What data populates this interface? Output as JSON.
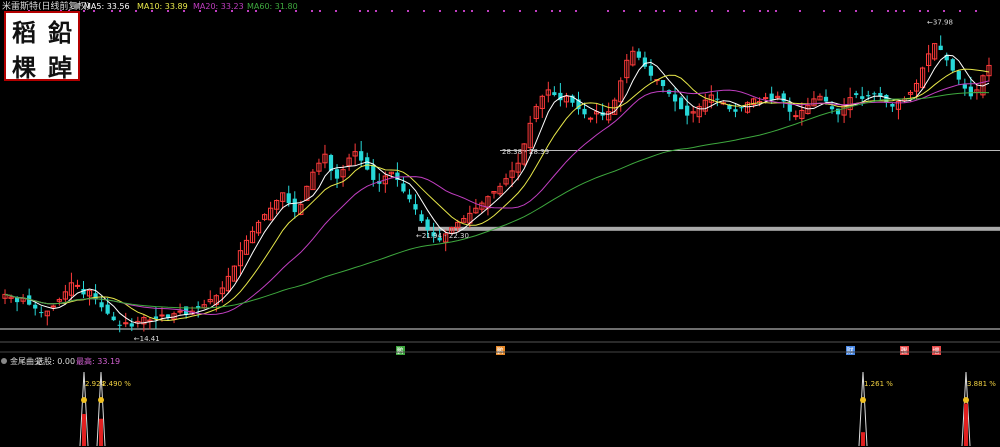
{
  "header": {
    "stock_name": "米雷斯特(日线前复权)",
    "ma5": "MA5: 33.56",
    "ma10": "MA10: 33.89",
    "ma20": "MA20: 33.23",
    "ma60": "MA60: 31.80"
  },
  "seal": {
    "chars": [
      "稻",
      "鉛",
      "棵",
      "踔"
    ]
  },
  "chart_data": [
    {
      "type": "candlestick",
      "title": "",
      "y_range": [
        13.5,
        39
      ],
      "series": [
        {
          "name": "MA5",
          "color": "#ffffff"
        },
        {
          "name": "MA10",
          "color": "#e8e84a"
        },
        {
          "name": "MA20",
          "color": "#c03ec0"
        },
        {
          "name": "MA60",
          "color": "#3ea83e"
        }
      ],
      "closes": [
        17.2,
        17.0,
        16.6,
        16.9,
        16.4,
        16.1,
        15.8,
        15.9,
        16.3,
        16.8,
        17.4,
        18.1,
        17.9,
        17.2,
        17.5,
        16.8,
        16.2,
        15.7,
        15.2,
        14.8,
        15.0,
        14.7,
        15.1,
        15.4,
        15.2,
        15.3,
        15.6,
        15.4,
        15.7,
        15.9,
        15.6,
        15.9,
        16.1,
        16.4,
        16.8,
        17.1,
        17.7,
        18.6,
        19.4,
        20.6,
        21.4,
        22.1,
        22.8,
        23.4,
        23.9,
        24.5,
        25.1,
        24.3,
        23.6,
        24.2,
        25.6,
        26.7,
        27.4,
        28.1,
        26.8,
        26.2,
        26.9,
        27.8,
        28.3,
        27.6,
        26.9,
        26.1,
        25.8,
        26.4,
        26.7,
        26.1,
        25.2,
        24.6,
        23.8,
        22.9,
        22.2,
        21.7,
        21.4,
        21.9,
        22.4,
        22.8,
        23.1,
        23.5,
        23.9,
        24.3,
        24.8,
        25.2,
        25.6,
        26.2,
        26.8,
        27.4,
        28.9,
        30.5,
        31.8,
        32.6,
        33.1,
        32.7,
        32.3,
        32.6,
        32.1,
        31.6,
        31.2,
        30.9,
        31.4,
        31.1,
        31.4,
        32.3,
        33.8,
        35.4,
        36.1,
        35.6,
        34.9,
        34.2,
        33.9,
        33.4,
        32.8,
        32.2,
        31.6,
        31.1,
        31.4,
        31.8,
        32.3,
        32.7,
        32.4,
        32.1,
        31.6,
        31.4,
        31.7,
        32.1,
        32.4,
        32.2,
        32.5,
        32.3,
        32.6,
        32.2,
        31.4,
        31.1,
        31.5,
        31.9,
        32.4,
        32.6,
        32.2,
        31.6,
        31.2,
        31.9,
        32.5,
        32.7,
        32.4,
        32.6,
        32.8,
        32.6,
        32.1,
        31.8,
        32.2,
        32.4,
        32.9,
        33.6,
        34.8,
        35.9,
        36.7,
        36.2,
        35.4,
        34.6,
        33.9,
        33.2,
        32.6,
        33.1,
        34.2,
        35.0
      ],
      "labels": [
        "14.41",
        "21.94 - 22.30",
        "28.38 - 28.39",
        "37.98"
      ],
      "support_lines": [
        22.3,
        28.39
      ],
      "markers": [
        "鹏",
        "鹏",
        "财",
        "骤",
        "增"
      ]
    },
    {
      "type": "bar",
      "title": "金尾曲尖 选股: 0.00",
      "values": [
        2.924,
        2.49,
        1.261,
        3.881
      ],
      "annotations": [
        "2.924",
        "2.490 %",
        "1.261 %",
        "3.881 %"
      ],
      "legend": "最高: 33.19"
    }
  ],
  "indicator": {
    "name": "金尾曲尖",
    "pick": "选股: 0.00",
    "high": "最高: 33.19"
  }
}
